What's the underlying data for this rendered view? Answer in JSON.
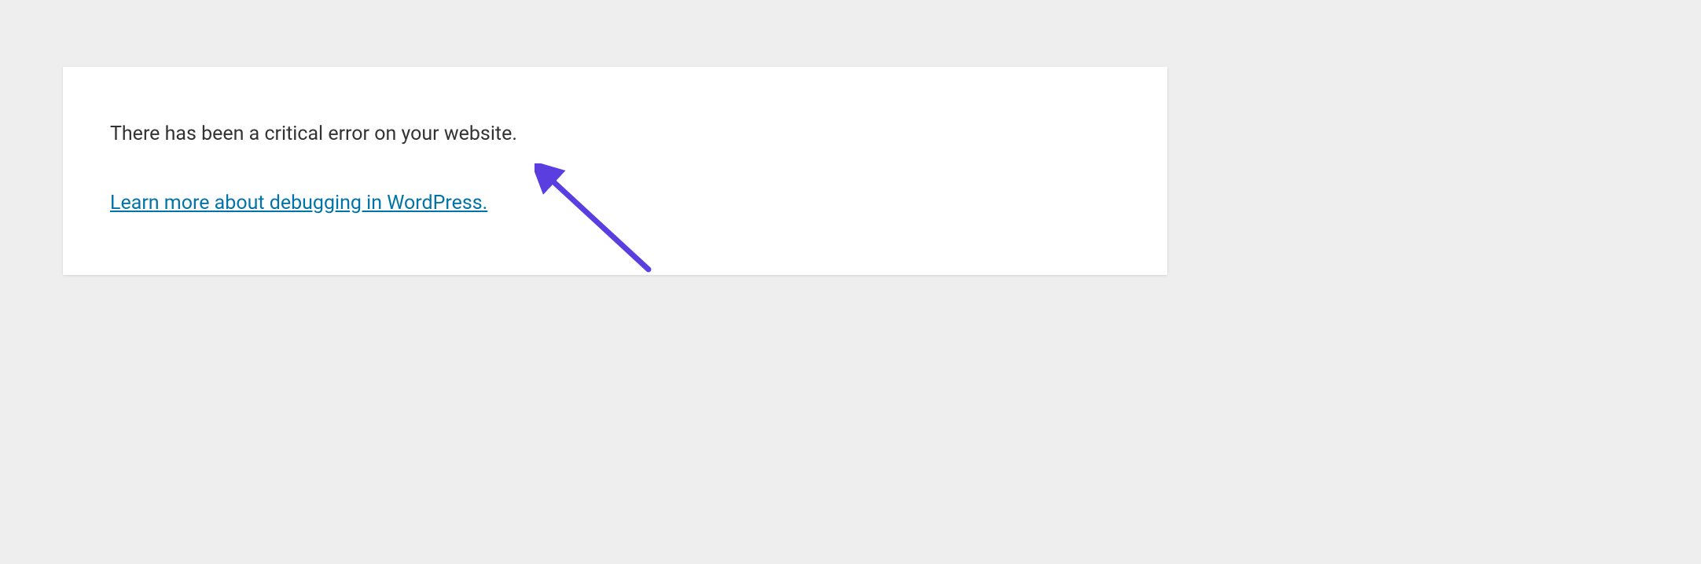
{
  "error": {
    "message": "There has been a critical error on your website.",
    "link_text": "Learn more about debugging in WordPress."
  },
  "annotation": {
    "arrow_color": "#5a3ee0"
  }
}
